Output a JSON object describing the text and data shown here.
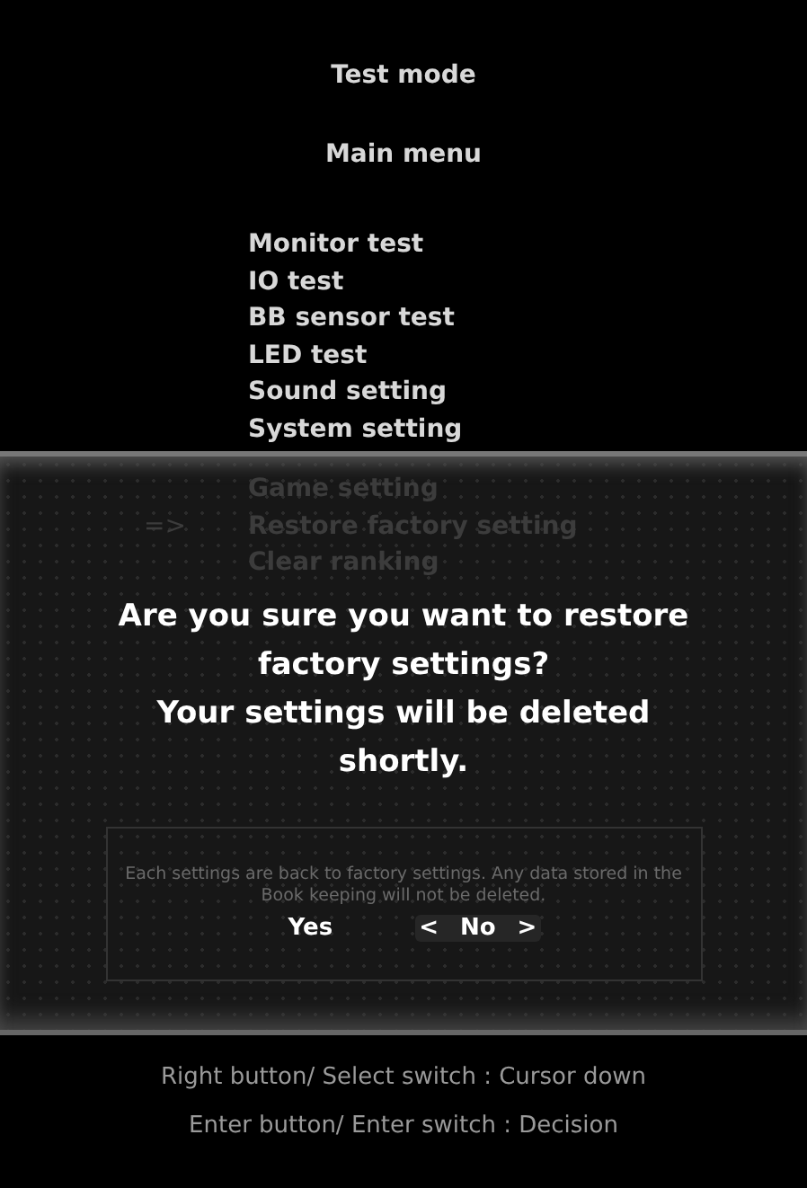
{
  "title": "Test mode",
  "subtitle": "Main menu",
  "cursor": "=>",
  "menu": {
    "items": [
      {
        "label": "Monitor test",
        "selected": false,
        "dimmed": false
      },
      {
        "label": "IO test",
        "selected": false,
        "dimmed": false
      },
      {
        "label": "BB sensor test",
        "selected": false,
        "dimmed": false
      },
      {
        "label": "LED test",
        "selected": false,
        "dimmed": false
      },
      {
        "label": "Sound setting",
        "selected": false,
        "dimmed": false
      },
      {
        "label": "System setting",
        "selected": false,
        "dimmed": false
      },
      {
        "label": "Game setting",
        "selected": false,
        "dimmed": true
      },
      {
        "label": "Restore factory setting",
        "selected": true,
        "dimmed": true
      },
      {
        "label": "Clear ranking",
        "selected": false,
        "dimmed": true
      }
    ]
  },
  "dialog": {
    "message": [
      "Are you sure you want to restore factory settings?",
      "Your settings will be deleted shortly."
    ],
    "note": "Each settings are back to factory settings. Any data stored in the Book keeping will not be deleted.",
    "choice_markers": [
      "<",
      ">"
    ],
    "choices": [
      {
        "label": "Yes",
        "selected": false
      },
      {
        "label": "No",
        "selected": true
      }
    ]
  },
  "help": [
    "Right button/ Select switch : Cursor down",
    "Enter button/ Enter switch : Decision"
  ]
}
